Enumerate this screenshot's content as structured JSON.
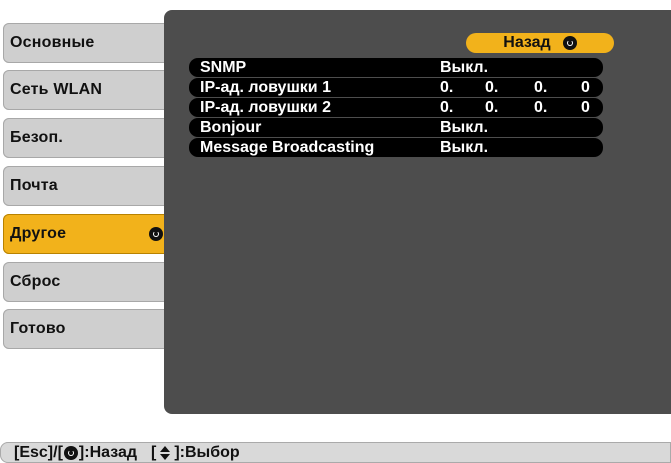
{
  "menu": {
    "items": [
      {
        "label": "Основные"
      },
      {
        "label": "Сеть WLAN"
      },
      {
        "label": "Безоп."
      },
      {
        "label": "Почта"
      },
      {
        "label": "Другое",
        "selected": true
      },
      {
        "label": "Сброс"
      },
      {
        "label": "Готово"
      }
    ]
  },
  "panel": {
    "back_label": "Назад",
    "rows": [
      {
        "name": "SNMP",
        "value": "Выкл."
      },
      {
        "name": "IP-ад. ловушки 1",
        "ip": [
          "0.",
          "0.",
          "0.",
          "0"
        ]
      },
      {
        "name": "IP-ад. ловушки 2",
        "ip": [
          "0.",
          "0.",
          "0.",
          "0"
        ]
      },
      {
        "name": "Bonjour",
        "value": "Выкл."
      },
      {
        "name": "Message Broadcasting",
        "value": "Выкл."
      }
    ]
  },
  "footer": {
    "esc": "[Esc]",
    "slash": "/[",
    "back_hint": "]:Назад",
    "select_open": "[",
    "select_hint": "]:Выбор"
  },
  "colors": {
    "accent": "#f2b21b",
    "panel": "#4d4d4d",
    "row": "#000000",
    "menu": "#cfcfcf"
  }
}
